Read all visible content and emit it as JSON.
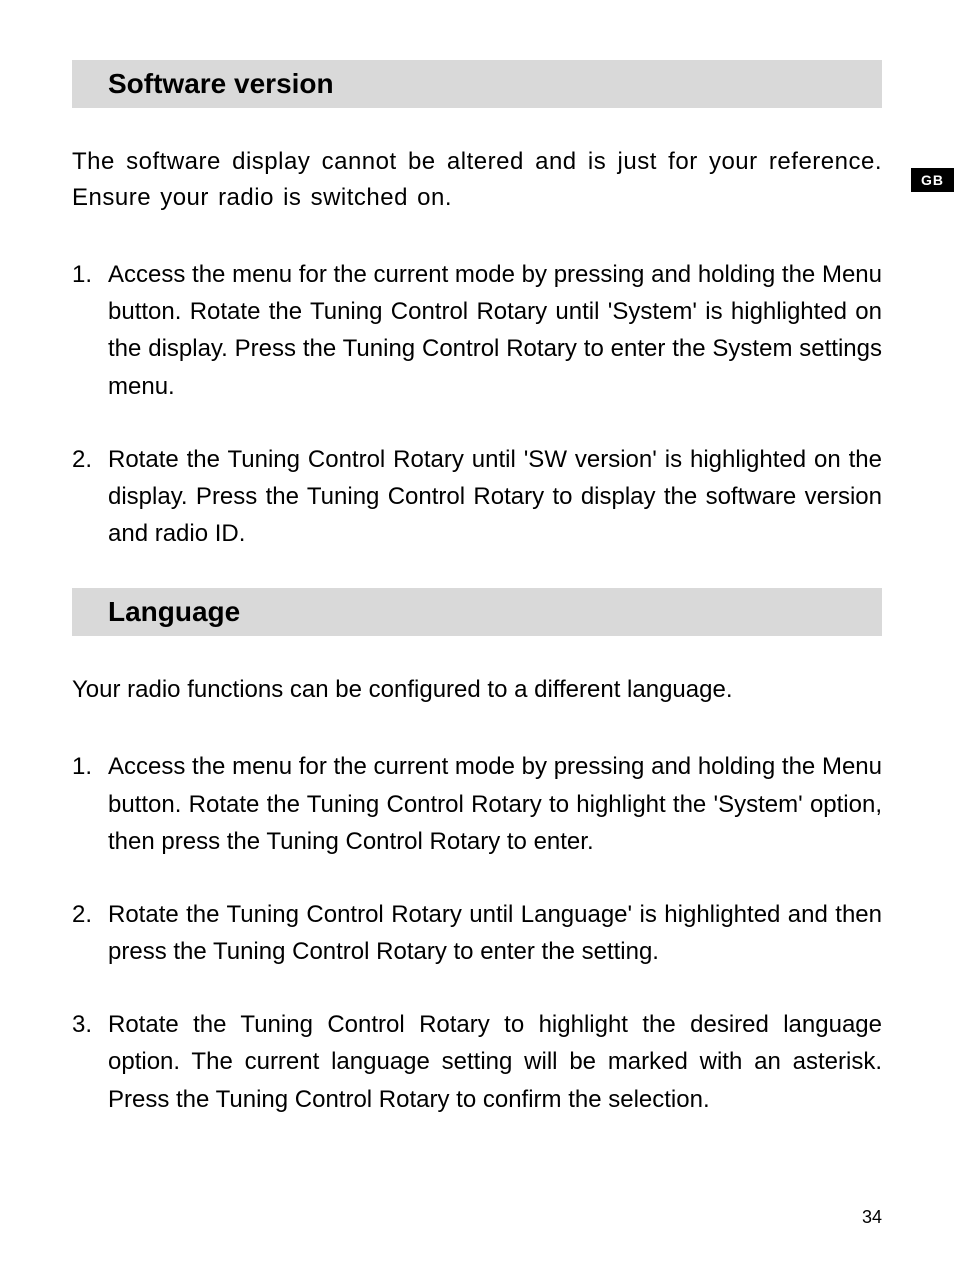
{
  "lang_tab": "GB",
  "page_number": "34",
  "section_sw": {
    "heading": "Software version",
    "intro": "The software display cannot be altered and is just for your reference. Ensure your radio is switched on.",
    "steps": [
      "Access the menu for the current mode by pressing and holding the Menu button. Rotate the Tuning Control Rotary until 'System' is highlighted on the display. Press the Tuning Control Rotary to enter the System settings menu.",
      "Rotate the Tuning Control Rotary until 'SW version' is highlighted on the display. Press the Tuning Control Rotary to display the software version and radio ID."
    ]
  },
  "section_lang": {
    "heading": "Language",
    "intro": "Your radio functions can be configured to a different language.",
    "steps": [
      "Access the menu for the current mode by pressing and holding the Menu button. Rotate the Tuning Control Rotary to highlight the 'System' option, then press the Tuning Control Rotary to enter.",
      "Rotate the Tuning Control Rotary until Language' is highlighted and then press the Tuning Control Rotary to enter the setting.",
      "Rotate the Tuning Control Rotary to highlight the desired language option. The current language setting will be marked with an asterisk. Press the Tuning Control Rotary to confirm the selection."
    ]
  },
  "numbers": [
    "1.",
    "2.",
    "3."
  ]
}
